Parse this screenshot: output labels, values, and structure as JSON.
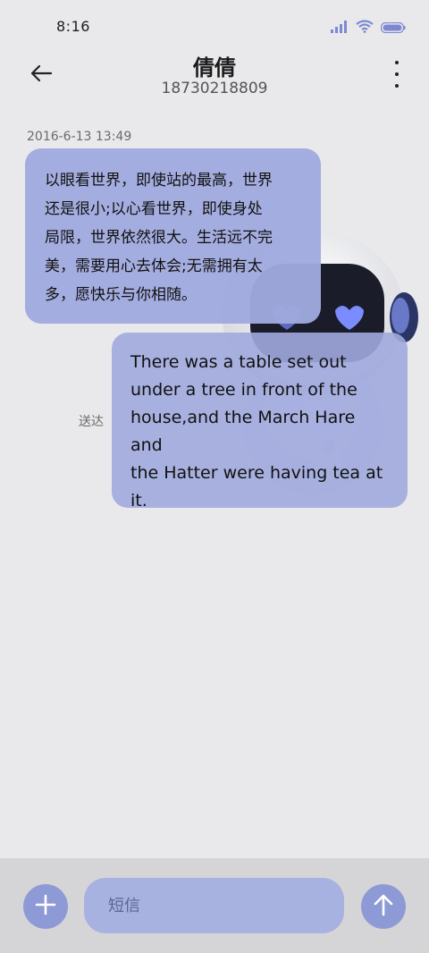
{
  "status_bar": {
    "time": "8:16",
    "icons": [
      "signal-icon",
      "wifi-icon",
      "battery-icon"
    ]
  },
  "header": {
    "contact_name": "倩倩",
    "contact_number": "18730218809",
    "back_icon": "back-arrow-icon",
    "more_icon": "more-vertical-icon"
  },
  "conversation": {
    "timestamp": "2016-6-13 13:49",
    "messages": [
      {
        "direction": "incoming",
        "lines": [
          "以眼看世界，即使站的最高，世界",
          "还是很小;以心看世界，即使身处",
          "局限，世界依然很大。生活远不完",
          "美，需要用心去体会;无需拥有太",
          "多，愿快乐与你相随。"
        ]
      },
      {
        "direction": "outgoing",
        "lines": [
          "There was a table set out",
          "under a tree in front of the",
          "house,and the March Hare and",
          "the Hatter were having tea at",
          "it."
        ],
        "status": "送达"
      }
    ]
  },
  "composer": {
    "placeholder": "短信",
    "add_icon": "plus-icon",
    "send_icon": "send-arrow-icon"
  },
  "colors": {
    "accent": "#8e9ad6",
    "bubble": "#a4aee0",
    "background": "#e9e9ec",
    "bottom_bar": "#d5d5d8"
  }
}
